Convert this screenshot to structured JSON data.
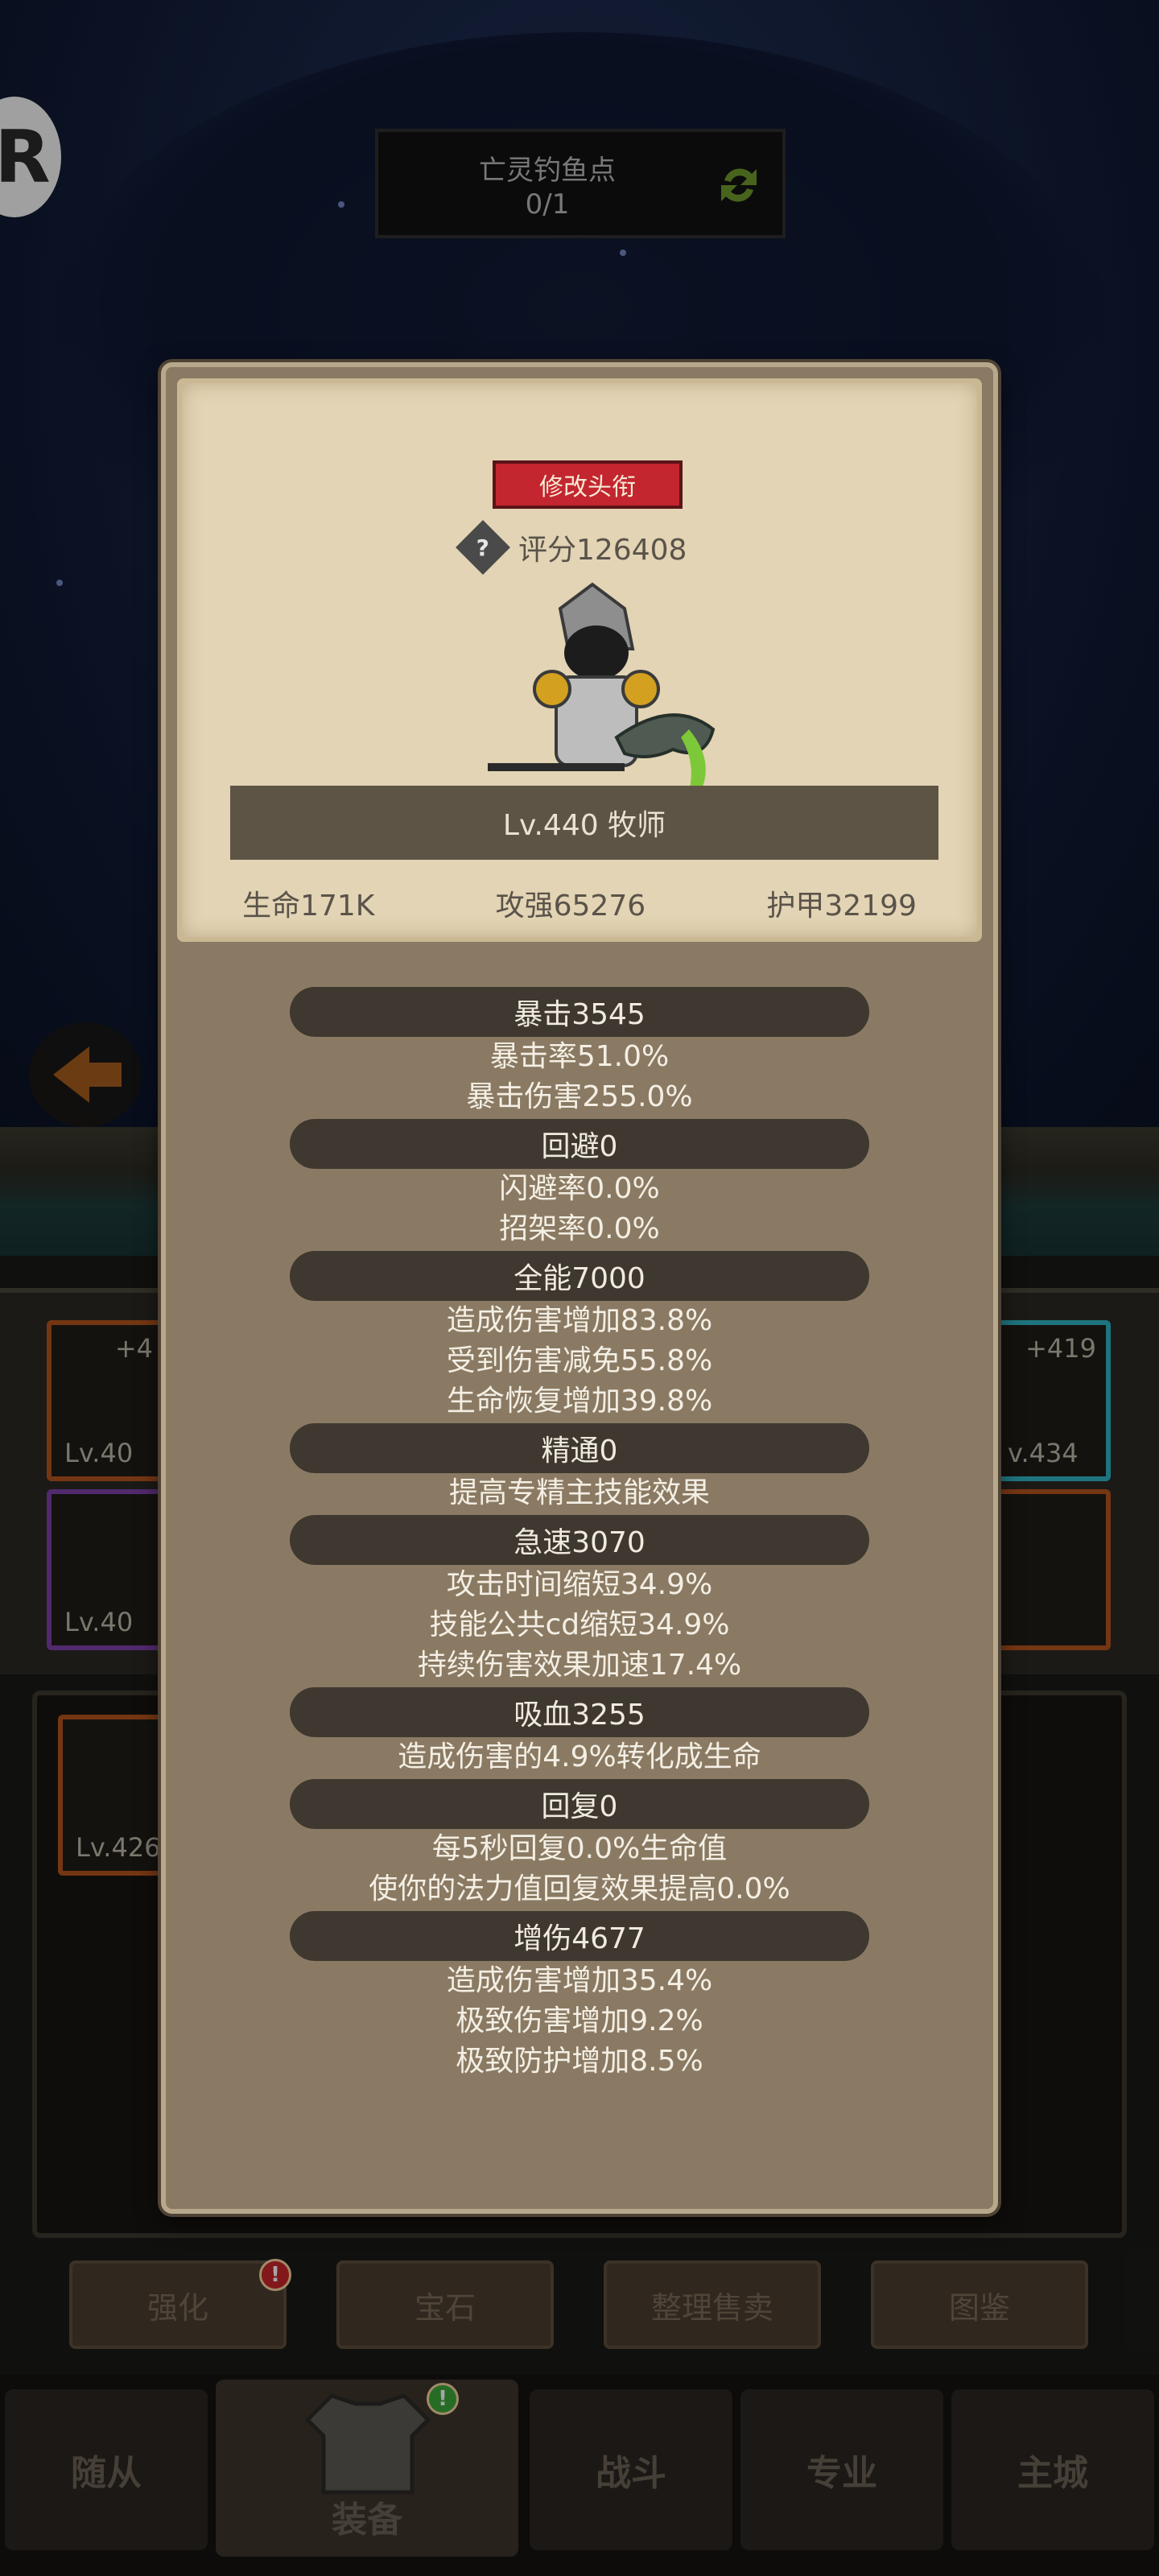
{
  "scene": {
    "fishing_spot_title": "亡灵钓鱼点",
    "fishing_spot_count": "0/1",
    "logo_letter": "R"
  },
  "equipment_slots": [
    {
      "plus": "+4",
      "level": "Lv.40"
    },
    {
      "plus": "",
      "level": "Lv.40"
    },
    {
      "plus": "+419",
      "level": "v.434"
    },
    {
      "plus": "",
      "level": "Lv.426"
    }
  ],
  "popup": {
    "change_title_button": "修改头衔",
    "score": "评分126408",
    "level_class": "Lv.440 牧师",
    "stats": {
      "hp": "生命171K",
      "attack": "攻强65276",
      "armor": "护甲32199"
    },
    "attributes": [
      {
        "header": "暴击3545",
        "lines": [
          "暴击率51.0%",
          "暴击伤害255.0%"
        ]
      },
      {
        "header": "回避0",
        "lines": [
          "闪避率0.0%",
          "招架率0.0%"
        ]
      },
      {
        "header": "全能7000",
        "lines": [
          "造成伤害增加83.8%",
          "受到伤害减免55.8%",
          "生命恢复增加39.8%"
        ]
      },
      {
        "header": "精通0",
        "lines": [
          "提高专精主技能效果"
        ]
      },
      {
        "header": "急速3070",
        "lines": [
          "攻击时间缩短34.9%",
          "技能公共cd缩短34.9%",
          "持续伤害效果加速17.4%"
        ]
      },
      {
        "header": "吸血3255",
        "lines": [
          "造成伤害的4.9%转化成生命"
        ]
      },
      {
        "header": "回复0",
        "lines": [
          "每5秒回复0.0%生命值",
          "使你的法力值回复效果提高0.0%"
        ]
      },
      {
        "header": "增伤4677",
        "lines": [
          "造成伤害增加35.4%",
          "极致伤害增加9.2%",
          "极致防护增加8.5%"
        ]
      }
    ]
  },
  "actions": [
    {
      "label": "强化",
      "badge": "!"
    },
    {
      "label": "宝石"
    },
    {
      "label": "整理售卖"
    },
    {
      "label": "图鉴"
    }
  ],
  "tabs": [
    {
      "label": "随从"
    },
    {
      "label": "装备",
      "badge": "!"
    },
    {
      "label": "战斗"
    },
    {
      "label": "专业"
    },
    {
      "label": "主城"
    }
  ],
  "colors": {
    "popup_bg": "#8a7a63",
    "card_bg": "#e2d4b4",
    "title_button": "#c3262e",
    "attr_header_bg": "#3f3830"
  }
}
